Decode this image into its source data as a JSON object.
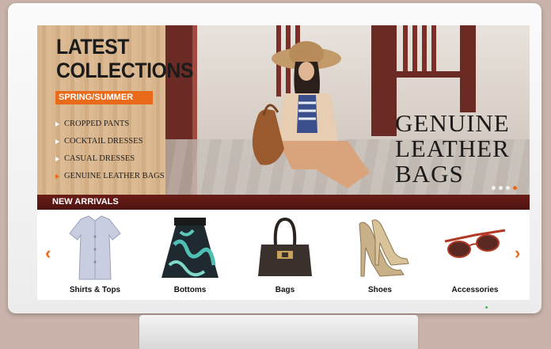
{
  "hero": {
    "title_line1": "LATEST",
    "title_line2": "COLLECTIONS",
    "season": "SPRING/SUMMER",
    "categories": [
      {
        "label": "CROPPED PANTS"
      },
      {
        "label": "COCKTAIL DRESSES"
      },
      {
        "label": "CASUAL DRESSES"
      },
      {
        "label": "GENUINE LEATHER BAGS"
      }
    ],
    "headline_line1": "GENUINE",
    "headline_line2": "LEATHER",
    "headline_line3": "BAGS",
    "slide_count": 4,
    "active_slide": 4
  },
  "new_arrivals": {
    "title": "NEW ARRIVALS",
    "prev_icon": "chevron-left-icon",
    "next_icon": "chevron-right-icon",
    "products": [
      {
        "label": "Shirts & Tops",
        "icon": "shirt-icon"
      },
      {
        "label": "Bottoms",
        "icon": "skirt-icon"
      },
      {
        "label": "Bags",
        "icon": "bag-icon"
      },
      {
        "label": "Shoes",
        "icon": "shoes-icon"
      },
      {
        "label": "Accessories",
        "icon": "sunglasses-icon"
      }
    ]
  },
  "colors": {
    "accent": "#e96b1a",
    "bar": "#5c1814",
    "backdrop": "#c9b3aa"
  }
}
